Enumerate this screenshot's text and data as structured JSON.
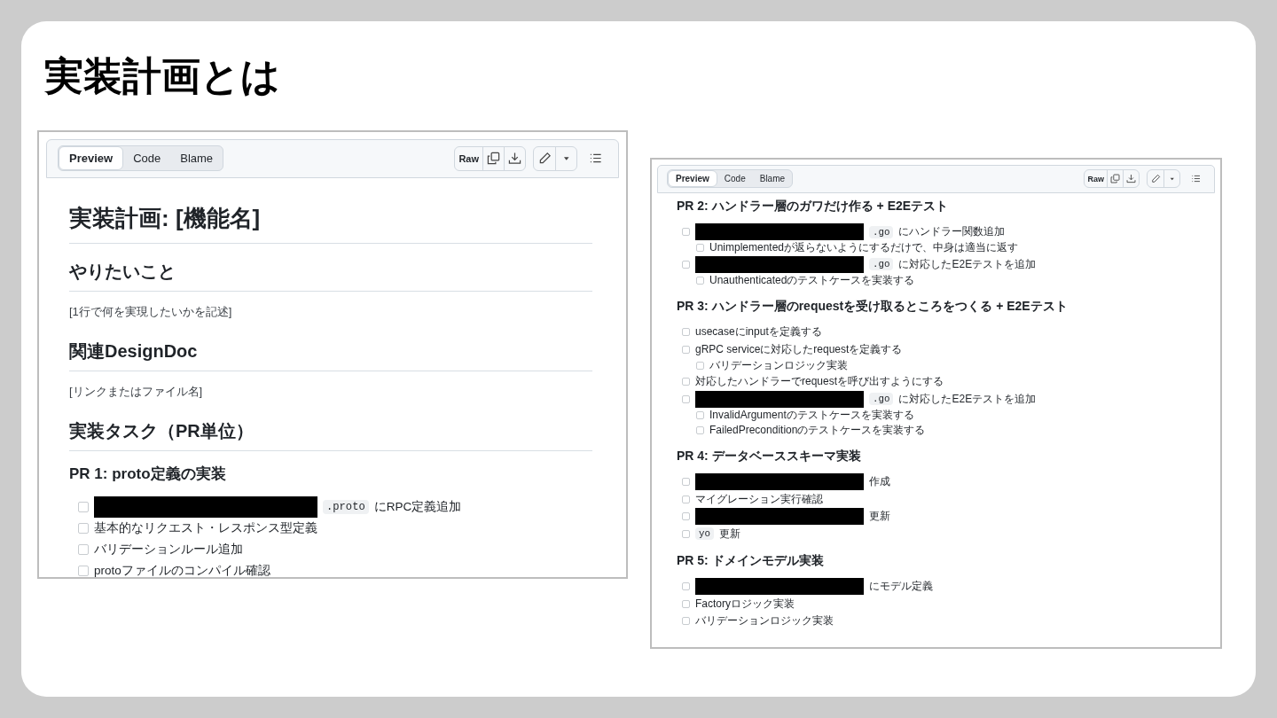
{
  "slide": {
    "title": "実装計画とは"
  },
  "panels": [
    {
      "tabs": [
        {
          "label": "Preview",
          "selected": true
        },
        {
          "label": "Code",
          "selected": false
        },
        {
          "label": "Blame",
          "selected": false
        }
      ],
      "toolbar": {
        "raw": "Raw"
      },
      "blocks": [
        {
          "kind": "h1",
          "text": "実装計画: [機能名]"
        },
        {
          "kind": "h2",
          "text": "やりたいこと"
        },
        {
          "kind": "p",
          "text": "[1行で何を実現したいかを記述]"
        },
        {
          "kind": "h2",
          "text": "関連DesignDoc"
        },
        {
          "kind": "p",
          "text": "[リンクまたはファイル名]"
        },
        {
          "kind": "h2",
          "text": "実装タスク（PR単位）"
        },
        {
          "kind": "h3",
          "text": "PR 1: proto定義の実装"
        },
        {
          "kind": "tasks",
          "items": [
            {
              "checked": false,
              "parts": [
                {
                  "kind": "redacted"
                },
                {
                  "kind": "code",
                  "text": ".proto"
                },
                {
                  "kind": "text",
                  "text": "にRPC定義追加"
                }
              ]
            },
            {
              "checked": false,
              "parts": [
                {
                  "kind": "text",
                  "text": "基本的なリクエスト・レスポンス型定義"
                }
              ]
            },
            {
              "checked": false,
              "parts": [
                {
                  "kind": "text",
                  "text": "バリデーションルール追加"
                }
              ]
            },
            {
              "checked": false,
              "parts": [
                {
                  "kind": "text",
                  "text": "protoファイルのコンパイル確認"
                }
              ]
            }
          ]
        }
      ]
    },
    {
      "tabs": [
        {
          "label": "Preview",
          "selected": true
        },
        {
          "label": "Code",
          "selected": false
        },
        {
          "label": "Blame",
          "selected": false
        }
      ],
      "toolbar": {
        "raw": "Raw"
      },
      "blocks": [
        {
          "kind": "h3",
          "text": "PR 2: ハンドラー層のガワだけ作る + E2Eテスト"
        },
        {
          "kind": "tasks",
          "items": [
            {
              "checked": false,
              "parts": [
                {
                  "kind": "redacted"
                },
                {
                  "kind": "code",
                  "text": ".go"
                },
                {
                  "kind": "text",
                  "text": "にハンドラー関数追加"
                }
              ],
              "children": [
                {
                  "checked": false,
                  "parts": [
                    {
                      "kind": "text",
                      "text": "Unimplementedが返らないようにするだけで、中身は適当に返す"
                    }
                  ]
                }
              ]
            },
            {
              "checked": false,
              "parts": [
                {
                  "kind": "redacted"
                },
                {
                  "kind": "code",
                  "text": ".go"
                },
                {
                  "kind": "text",
                  "text": "に対応したE2Eテストを追加"
                }
              ],
              "children": [
                {
                  "checked": false,
                  "parts": [
                    {
                      "kind": "text",
                      "text": "Unauthenticatedのテストケースを実装する"
                    }
                  ]
                }
              ]
            }
          ]
        },
        {
          "kind": "h3",
          "text": "PR 3: ハンドラー層のrequestを受け取るところをつくる + E2Eテスト"
        },
        {
          "kind": "tasks",
          "items": [
            {
              "checked": false,
              "parts": [
                {
                  "kind": "text",
                  "text": "usecaseにinputを定義する"
                }
              ]
            },
            {
              "checked": false,
              "parts": [
                {
                  "kind": "text",
                  "text": "gRPC serviceに対応したrequestを定義する"
                }
              ],
              "children": [
                {
                  "checked": false,
                  "parts": [
                    {
                      "kind": "text",
                      "text": "バリデーションロジック実装"
                    }
                  ]
                }
              ]
            },
            {
              "checked": false,
              "parts": [
                {
                  "kind": "text",
                  "text": "対応したハンドラーでrequestを呼び出すようにする"
                }
              ]
            },
            {
              "checked": false,
              "parts": [
                {
                  "kind": "redacted"
                },
                {
                  "kind": "code",
                  "text": ".go"
                },
                {
                  "kind": "text",
                  "text": "に対応したE2Eテストを追加"
                }
              ],
              "children": [
                {
                  "checked": false,
                  "parts": [
                    {
                      "kind": "text",
                      "text": "InvalidArgumentのテストケースを実装する"
                    }
                  ]
                },
                {
                  "checked": false,
                  "parts": [
                    {
                      "kind": "text",
                      "text": "FailedPreconditionのテストケースを実装する"
                    }
                  ]
                }
              ]
            }
          ]
        },
        {
          "kind": "h3",
          "text": "PR 4: データベーススキーマ実装"
        },
        {
          "kind": "tasks",
          "items": [
            {
              "checked": false,
              "parts": [
                {
                  "kind": "redacted"
                },
                {
                  "kind": "text",
                  "text": "作成"
                }
              ]
            },
            {
              "checked": false,
              "parts": [
                {
                  "kind": "text",
                  "text": "マイグレーション実行確認"
                }
              ]
            },
            {
              "checked": false,
              "parts": [
                {
                  "kind": "redacted"
                },
                {
                  "kind": "text",
                  "text": "更新"
                }
              ]
            },
            {
              "checked": false,
              "parts": [
                {
                  "kind": "code",
                  "text": "yo"
                },
                {
                  "kind": "text",
                  "text": "更新"
                }
              ]
            }
          ]
        },
        {
          "kind": "h3",
          "text": "PR 5: ドメインモデル実装"
        },
        {
          "kind": "tasks",
          "items": [
            {
              "checked": false,
              "parts": [
                {
                  "kind": "redacted"
                },
                {
                  "kind": "text",
                  "text": "にモデル定義"
                }
              ]
            },
            {
              "checked": false,
              "parts": [
                {
                  "kind": "text",
                  "text": "Factoryロジック実装"
                }
              ]
            },
            {
              "checked": false,
              "parts": [
                {
                  "kind": "text",
                  "text": "バリデーションロジック実装"
                }
              ]
            }
          ]
        }
      ]
    }
  ]
}
